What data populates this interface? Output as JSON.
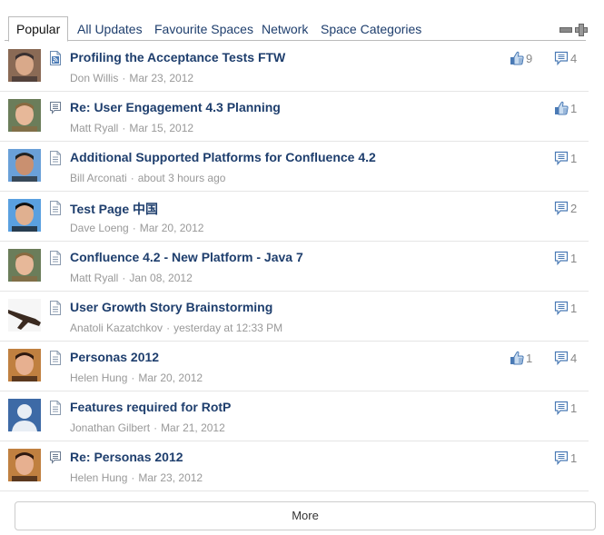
{
  "tabs": [
    {
      "label": "Popular",
      "active": true
    },
    {
      "label": "All Updates",
      "active": false
    },
    {
      "label": "Favourite Spaces",
      "active": false
    },
    {
      "label": "Network",
      "active": false
    },
    {
      "label": "Space Categories",
      "active": false
    }
  ],
  "tools": {
    "collapse_icon": "minus-icon",
    "expand_icon": "plus-icon"
  },
  "items": [
    {
      "title": "Profiling the Acceptance Tests FTW",
      "author": "Don Willis",
      "date": "Mar 23, 2012",
      "type": "blog-post",
      "likes": "9",
      "comments": "4",
      "avatar": "photo"
    },
    {
      "title": "Re: User Engagement 4.3 Planning",
      "author": "Matt Ryall",
      "date": "Mar 15, 2012",
      "type": "comment",
      "likes": "1",
      "comments": null,
      "avatar": "photo"
    },
    {
      "title": "Additional Supported Platforms for Confluence 4.2",
      "author": "Bill Arconati",
      "date": "about 3 hours ago",
      "type": "page",
      "likes": null,
      "comments": "1",
      "avatar": "photo"
    },
    {
      "title": "Test Page 中国",
      "author": "Dave Loeng",
      "date": "Mar 20, 2012",
      "type": "page",
      "likes": null,
      "comments": "2",
      "avatar": "photo"
    },
    {
      "title": "Confluence 4.2 - New Platform - Java 7",
      "author": "Matt Ryall",
      "date": "Jan 08, 2012",
      "type": "page",
      "likes": null,
      "comments": "1",
      "avatar": "photo"
    },
    {
      "title": "User Growth Story Brainstorming",
      "author": "Anatoli Kazatchkov",
      "date": "yesterday at 12:33 PM",
      "type": "page",
      "likes": null,
      "comments": "1",
      "avatar": "photo"
    },
    {
      "title": "Personas 2012",
      "author": "Helen Hung",
      "date": "Mar 20, 2012",
      "type": "page",
      "likes": "1",
      "comments": "4",
      "avatar": "photo"
    },
    {
      "title": "Features required for RotP",
      "author": "Jonathan Gilbert",
      "date": "Mar 21, 2012",
      "type": "page",
      "likes": null,
      "comments": "1",
      "avatar": "default"
    },
    {
      "title": "Re: Personas 2012",
      "author": "Helen Hung",
      "date": "Mar 23, 2012",
      "type": "comment",
      "likes": null,
      "comments": "1",
      "avatar": "photo"
    }
  ],
  "meta_separator": "·",
  "more_label": "More",
  "colors": {
    "link": "#1e3e6d",
    "meta": "#999999",
    "icon_blue": "#4a7ab5",
    "border": "#bbbbbb"
  }
}
